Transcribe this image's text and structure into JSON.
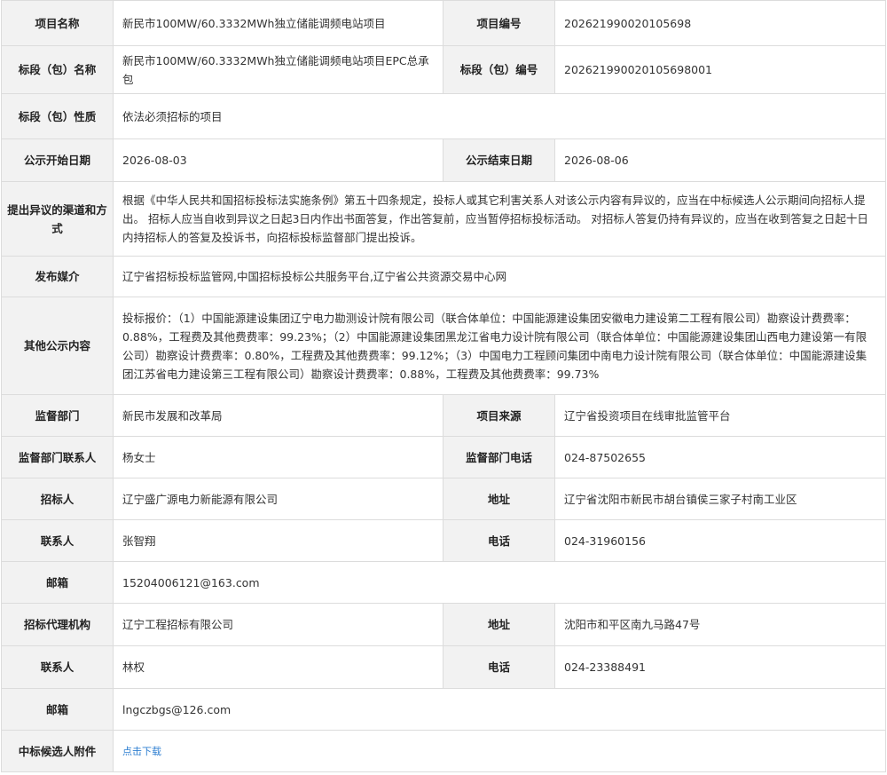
{
  "rows": {
    "r1": {
      "l1": "项目名称",
      "v1": "新民市100MW/60.3332MWh独立储能调频电站项目",
      "l2": "项目编号",
      "v2": "202621990020105698"
    },
    "r2": {
      "l1": "标段（包）名称",
      "v1": "新民市100MW/60.3332MWh独立储能调频电站项目EPC总承包",
      "l2": "标段（包）编号",
      "v2": "202621990020105698001"
    },
    "r3": {
      "l1": "标段（包）性质",
      "v1": "依法必须招标的项目"
    },
    "r4": {
      "l1": "公示开始日期",
      "v1": "2026-08-03",
      "l2": "公示结束日期",
      "v2": "2026-08-06"
    },
    "r5": {
      "l1": "提出异议的渠道和方式",
      "v1": "根据《中华人民共和国招标投标法实施条例》第五十四条规定，投标人或其它利害关系人对该公示内容有异议的，应当在中标候选人公示期间向招标人提出。 招标人应当自收到异议之日起3日内作出书面答复，作出答复前，应当暂停招标投标活动。 对招标人答复仍持有异议的，应当在收到答复之日起十日内持招标人的答复及投诉书，向招标投标监督部门提出投诉。"
    },
    "r6": {
      "l1": "发布媒介",
      "v1": "辽宁省招标投标监管网,中国招标投标公共服务平台,辽宁省公共资源交易中心网"
    },
    "r7": {
      "l1": "其他公示内容",
      "v1": "投标报价：（1）中国能源建设集团辽宁电力勘测设计院有限公司（联合体单位：中国能源建设集团安徽电力建设第二工程有限公司）勘察设计费费率：0.88%，工程费及其他费费率：99.23%；（2）中国能源建设集团黑龙江省电力设计院有限公司（联合体单位：中国能源建设集团山西电力建设第一有限公司）勘察设计费费率：0.80%，工程费及其他费费率：99.12%；（3）中国电力工程顾问集团中南电力设计院有限公司（联合体单位：中国能源建设集团江苏省电力建设第三工程有限公司）勘察设计费费率：0.88%，工程费及其他费费率：99.73%"
    },
    "r8": {
      "l1": "监督部门",
      "v1": "新民市发展和改革局",
      "l2": "项目来源",
      "v2": "辽宁省投资项目在线审批监管平台"
    },
    "r9": {
      "l1": "监督部门联系人",
      "v1": "杨女士",
      "l2": "监督部门电话",
      "v2": "024-87502655"
    },
    "r10": {
      "l1": "招标人",
      "v1": "辽宁盛广源电力新能源有限公司",
      "l2": "地址",
      "v2": "辽宁省沈阳市新民市胡台镇侯三家子村南工业区"
    },
    "r11": {
      "l1": "联系人",
      "v1": "张智翔",
      "l2": "电话",
      "v2": "024-31960156"
    },
    "r12": {
      "l1": "邮箱",
      "v1": "15204006121@163.com"
    },
    "r13": {
      "l1": "招标代理机构",
      "v1": "辽宁工程招标有限公司",
      "l2": "地址",
      "v2": "沈阳市和平区南九马路47号"
    },
    "r14": {
      "l1": "联系人",
      "v1": "林权",
      "l2": "电话",
      "v2": "024-23388491"
    },
    "r15": {
      "l1": "邮箱",
      "v1": "lngczbgs@126.com"
    },
    "r16": {
      "l1": "中标候选人附件",
      "v1": "点击下载"
    }
  }
}
